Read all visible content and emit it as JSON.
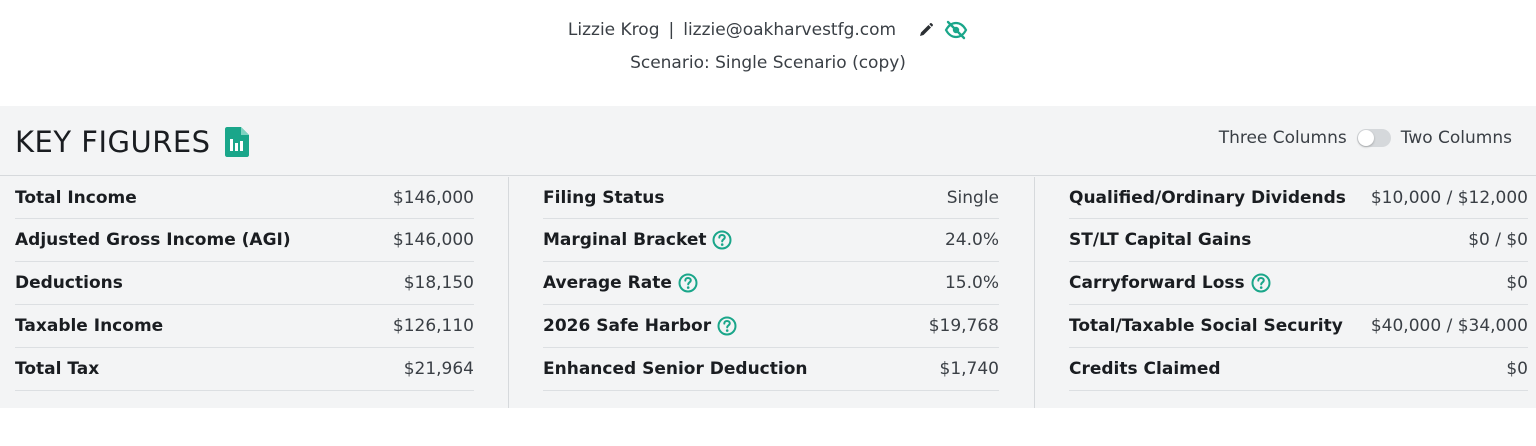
{
  "header": {
    "user_name": "Lizzie Krog",
    "separator": "|",
    "user_email": "lizzie@oakharvestfg.com",
    "scenario": "Scenario: Single Scenario (copy)",
    "edit_icon": "pencil-icon",
    "visibility_icon": "eye-off-icon"
  },
  "panel": {
    "title": "KEY FIGURES",
    "report_icon": "report-file-icon",
    "toggle_left": "Three Columns",
    "toggle_right": "Two Columns",
    "toggle_state": "Three Columns"
  },
  "colors": {
    "accent": "#1aa68a",
    "panel_bg": "#f3f4f5",
    "border": "#d6d9dc"
  },
  "columns": [
    {
      "rows": [
        {
          "label": "Total Income",
          "value": "$146,000"
        },
        {
          "label": "Adjusted Gross Income (AGI)",
          "value": "$146,000"
        },
        {
          "label": "Deductions",
          "value": "$18,150"
        },
        {
          "label": "Taxable Income",
          "value": "$126,110"
        },
        {
          "label": "Total Tax",
          "value": "$21,964"
        }
      ]
    },
    {
      "rows": [
        {
          "label": "Filing Status",
          "value": "Single"
        },
        {
          "label": "Marginal Bracket",
          "value": "24.0%",
          "help": true
        },
        {
          "label": "Average Rate",
          "value": "15.0%",
          "help": true
        },
        {
          "label": "2026 Safe Harbor",
          "value": "$19,768",
          "help": true
        },
        {
          "label": "Enhanced Senior Deduction",
          "value": "$1,740"
        }
      ]
    },
    {
      "rows": [
        {
          "label": "Qualified/Ordinary Dividends",
          "value": "$10,000 / $12,000"
        },
        {
          "label": "ST/LT Capital Gains",
          "value": "$0 / $0"
        },
        {
          "label": "Carryforward Loss",
          "value": "$0",
          "help": true
        },
        {
          "label": "Total/Taxable Social Security",
          "value": "$40,000 / $34,000"
        },
        {
          "label": "Credits Claimed",
          "value": "$0"
        }
      ]
    }
  ]
}
